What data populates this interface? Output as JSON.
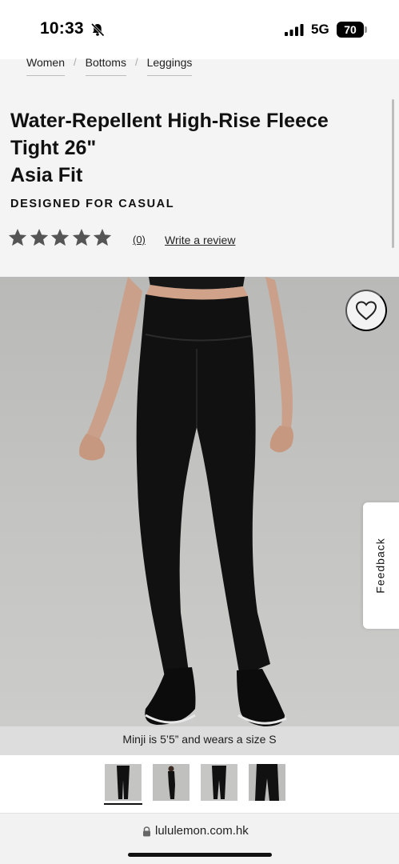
{
  "status_bar": {
    "time": "10:33",
    "network": "5G",
    "battery": "70"
  },
  "breadcrumb": {
    "items": [
      "Women",
      "Bottoms",
      "Leggings"
    ],
    "separator": "/"
  },
  "product": {
    "title_lines": [
      "Water-Repellent High-Rise Fleece",
      "Tight 26\"",
      "Asia Fit"
    ],
    "designed_for": "DESIGNED FOR CASUAL",
    "rating": 0,
    "rating_max": 5,
    "review_count": "(0)",
    "write_review": "Write a review"
  },
  "image": {
    "caption": "Minji is 5’5” and wears a size S"
  },
  "feedback": {
    "label": "Feedback"
  },
  "thumbnails": {
    "count": 4,
    "selected_index": 0
  },
  "browser": {
    "url": "lululemon.com.hk"
  },
  "colors": {
    "star": "#555555",
    "legging": "#111111",
    "image_background": "#c4c4c2",
    "accent": "#111111"
  }
}
